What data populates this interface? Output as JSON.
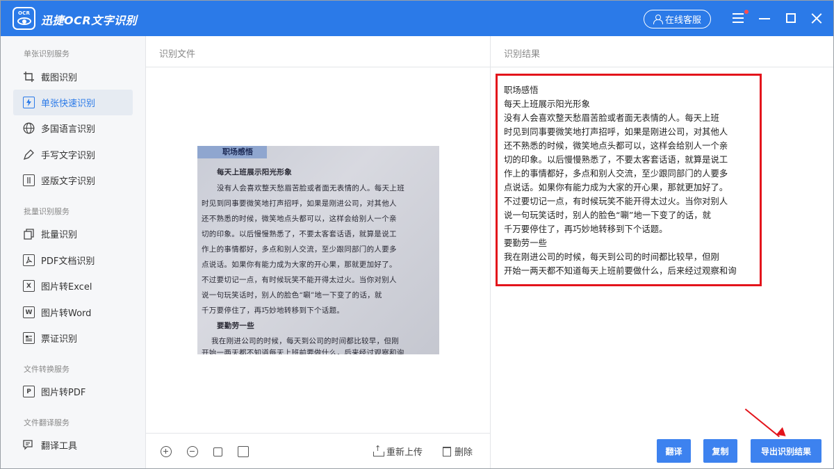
{
  "app": {
    "title": "迅捷OCR文字识别",
    "logo_text": "OCR",
    "online_service": "在线客服"
  },
  "sidebar": {
    "sections": [
      {
        "title": "单张识别服务"
      },
      {
        "title": "批量识别服务"
      },
      {
        "title": "文件转换服务"
      },
      {
        "title": "文件翻译服务"
      }
    ],
    "items": [
      {
        "label": "截图识别",
        "icon": "crop-icon"
      },
      {
        "label": "单张快速识别",
        "icon": "quick-recognize-icon",
        "active": true
      },
      {
        "label": "多国语言识别",
        "icon": "globe-icon"
      },
      {
        "label": "手写文字识别",
        "icon": "pen-icon"
      },
      {
        "label": "竖版文字识别",
        "icon": "vertical-text-icon"
      },
      {
        "label": "批量识别",
        "icon": "batch-icon"
      },
      {
        "label": "PDF文档识别",
        "icon": "pdf-icon"
      },
      {
        "label": "图片转Excel",
        "icon": "excel-icon",
        "glyph": "X"
      },
      {
        "label": "图片转Word",
        "icon": "word-icon",
        "glyph": "W"
      },
      {
        "label": "票证识别",
        "icon": "ticket-icon"
      },
      {
        "label": "图片转PDF",
        "icon": "pdf-file-icon",
        "glyph": "P"
      },
      {
        "label": "翻译工具",
        "icon": "translate-icon"
      }
    ]
  },
  "mid_panel": {
    "header": "识别文件",
    "scan": {
      "title": "职场感悟",
      "lines": [
        "每天上班展示阳光形象",
        "没有人会喜欢整天愁眉苦脸或者面无表情的人。每天上班",
        "时见到同事要微笑地打声招呼，如果是刚进公司，对其他人",
        "还不熟悉的时候，微笑地点头都可以，这样会给别人一个亲",
        "切的印象。以后慢慢熟悉了，不要太客套话语，就算是说工",
        "作上的事情都好，多点和别人交流，至少跟同部门的人要多",
        "点说话。如果你有能力成为大家的开心果，那就更加好了。",
        "不过要切记一点，有时候玩笑不能开得太过火。当你对别人",
        "说一句玩笑话时，别人的脸色“唰”地一下变了的话，就",
        "千万要停住了，再巧妙地转移到下个话题。",
        "要勤劳一些",
        "我在刚进公司的时候，每天到公司的时间都比较早，但刚",
        "开始一两天都不知道每天上班前要做什么，后来经过观察和询"
      ]
    },
    "toolbar": {
      "reupload": "重新上传",
      "delete": "删除"
    }
  },
  "right_panel": {
    "header": "识别结果",
    "result_lines": [
      "职场感悟",
      "每天上班展示阳光形象",
      "没有人会喜欢整天愁眉苦脸或者面无表情的人。每天上班",
      "时见到同事要微笑地打声招呼，如果是刚进公司，对其他人",
      "还不熟悉的时候，微笑地点头都可以，这样会给别人一个亲",
      "切的印象。以后慢慢熟悉了，不要太客套话语，就算是说工",
      "作上的事情都好，多点和别人交流，至少跟同部门的人要多",
      "点说话。如果你有能力成为大家的开心果，那就更加好了。",
      "不过要切记一点，有时候玩笑不能开得太过火。当你对别人",
      "说一句玩笑话时，别人的脸色“唰”地一下变了的话，就",
      "千万要停住了，再巧妙地转移到下个话题。",
      "要勤劳一些",
      "我在刚进公司的时候，每天到公司的时间都比较早，但刚",
      "开始一两天都不知道每天上班前要做什么，后来经过观察和询"
    ],
    "buttons": {
      "translate": "翻译",
      "copy": "复制",
      "export": "导出识别结果"
    }
  },
  "colors": {
    "titlebar": "#2b7ae8",
    "accent_button": "#3d82ef",
    "highlight_box": "#e3141b"
  }
}
